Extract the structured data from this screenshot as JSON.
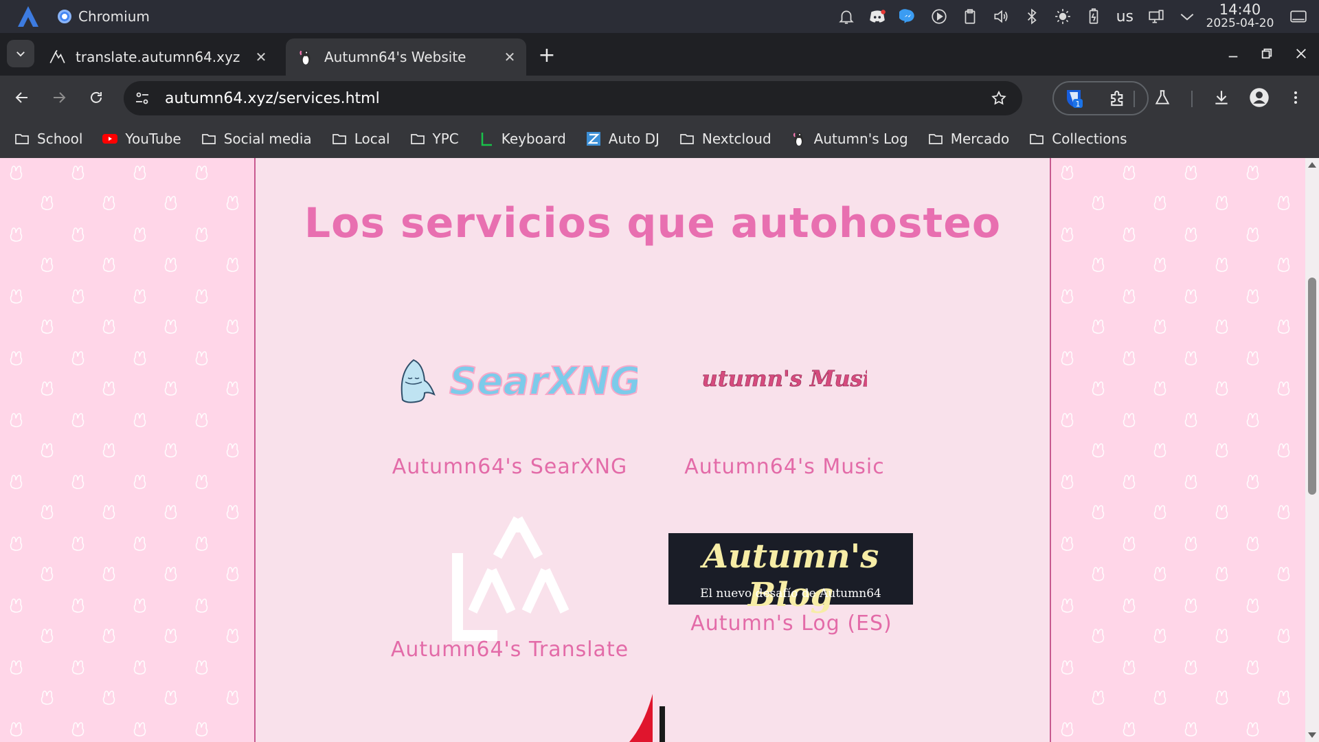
{
  "panel": {
    "app_name": "Chromium",
    "keyboard_layout": "us",
    "time": "14:40",
    "date": "2025-04-20",
    "icons": [
      "notifications-icon",
      "discord-icon",
      "messenger-icon",
      "media-player-icon",
      "clipboard-icon",
      "volume-icon",
      "bluetooth-icon",
      "brightness-icon",
      "battery-icon",
      "display-icon",
      "tray-expand-icon"
    ]
  },
  "tabs": [
    {
      "title": "translate.autumn64.xyz",
      "active": false
    },
    {
      "title": "Autumn64's Website",
      "active": true
    }
  ],
  "toolbar": {
    "url": "autumn64.xyz/services.html",
    "extension_badge": "1"
  },
  "bookmarks": [
    {
      "label": "School",
      "icon": "folder-icon"
    },
    {
      "label": "YouTube",
      "icon": "youtube-icon"
    },
    {
      "label": "Social media",
      "icon": "folder-icon"
    },
    {
      "label": "Local",
      "icon": "folder-icon"
    },
    {
      "label": "YPC",
      "icon": "folder-icon"
    },
    {
      "label": "Keyboard",
      "icon": "keyboard-site-icon"
    },
    {
      "label": "Auto DJ",
      "icon": "autodj-icon"
    },
    {
      "label": "Nextcloud",
      "icon": "folder-icon"
    },
    {
      "label": "Autumn's Log",
      "icon": "penguin-icon"
    },
    {
      "label": "Mercado",
      "icon": "folder-icon"
    },
    {
      "label": "Collections",
      "icon": "folder-icon"
    }
  ],
  "page": {
    "title": "Los servicios que autohosteo",
    "services": [
      {
        "label": "Autumn64's SearXNG",
        "logo_text": "SearXNG"
      },
      {
        "label": "Autumn64's Music",
        "logo_text": "Autumn's Music"
      },
      {
        "label": "Autumn64's Translate",
        "logo_text": ""
      },
      {
        "label": "Autumn's Log (ES)",
        "logo_text": "Autumn's Blog",
        "logo_subtitle": "El nuevo desafío de Autumn64"
      }
    ]
  },
  "colors": {
    "accent_pink": "#e86fb0",
    "page_bg": "#f9e1eb",
    "pattern_bg": "#ffd6e8",
    "browser_dark": "#35363a"
  }
}
